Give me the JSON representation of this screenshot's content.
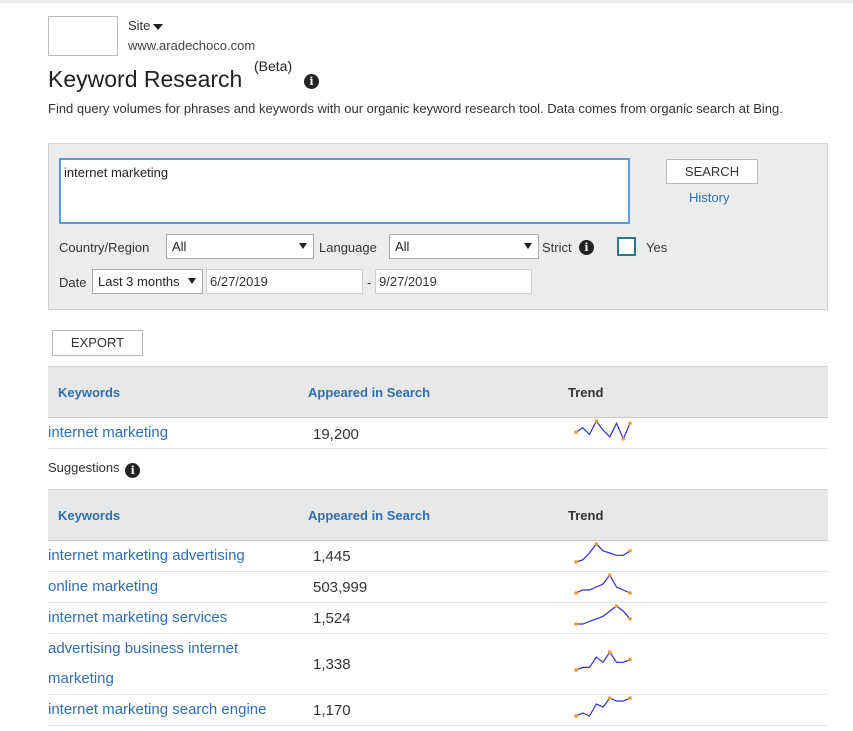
{
  "site": {
    "label": "Site",
    "url": "www.aradechoco.com"
  },
  "page": {
    "title": "Keyword Research",
    "badge": "(Beta)",
    "description": "Find query volumes for phrases and keywords with our organic keyword research tool. Data comes from organic search at Bing."
  },
  "search": {
    "query": "internet marketing",
    "search_label": "SEARCH",
    "history_label": "History"
  },
  "filters": {
    "country_label": "Country/Region",
    "country_value": "All",
    "language_label": "Language",
    "language_value": "All",
    "strict_label": "Strict",
    "strict_checked": false,
    "yes_label": "Yes",
    "date_label": "Date",
    "date_range_value": "Last 3 months",
    "date_from": "6/27/2019",
    "date_sep": "-",
    "date_to": "9/27/2019"
  },
  "export_label": "EXPORT",
  "table_headers": {
    "keywords": "Keywords",
    "appeared": "Appeared in Search",
    "trend": "Trend"
  },
  "main_result": {
    "keyword": "internet marketing",
    "appeared": "19,200",
    "trend": [
      4,
      6,
      3,
      9,
      5,
      2,
      8,
      1,
      8
    ]
  },
  "suggestions_label": "Suggestions",
  "suggestions": [
    {
      "keyword": "internet marketing advertising",
      "appeared": "1,445",
      "trend": [
        1,
        2,
        5,
        9,
        6,
        5,
        4,
        4,
        6
      ]
    },
    {
      "keyword": "online marketing",
      "appeared": "503,999",
      "trend": [
        3,
        4,
        4,
        5,
        6,
        9,
        5,
        4,
        3
      ]
    },
    {
      "keyword": "internet marketing services",
      "appeared": "1,524",
      "trend": [
        1,
        1,
        2,
        3,
        4,
        6,
        8,
        6,
        3
      ]
    },
    {
      "keyword": "advertising business internet marketing",
      "appeared": "1,338",
      "trend": [
        2,
        3,
        3,
        7,
        5,
        9,
        5,
        5,
        6
      ]
    },
    {
      "keyword": "internet marketing search engine",
      "appeared": "1,170",
      "trend": [
        2,
        3,
        2,
        6,
        5,
        8,
        7,
        7,
        8
      ]
    }
  ],
  "colors": {
    "trend_line": "#2f2fcf",
    "trend_marker": "#f29a2e",
    "link": "#2f6fb2"
  }
}
